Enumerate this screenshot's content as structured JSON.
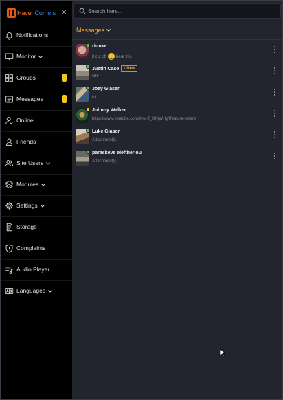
{
  "app": {
    "brand_part1": "Haven",
    "brand_part2": "Comms",
    "close_glyph": "×"
  },
  "sidebar": {
    "items": [
      {
        "label": "Notifications",
        "icon": "bell-icon",
        "has_chevron": false,
        "badge": false
      },
      {
        "label": "Monitor",
        "icon": "monitor-icon",
        "has_chevron": true,
        "badge": false
      },
      {
        "label": "Groups",
        "icon": "grid-icon",
        "has_chevron": false,
        "badge": true
      },
      {
        "label": "Messages",
        "icon": "message-icon",
        "has_chevron": false,
        "badge": true
      },
      {
        "label": "Online",
        "icon": "user-online-icon",
        "has_chevron": false,
        "badge": false
      },
      {
        "label": "Friends",
        "icon": "friends-icon",
        "has_chevron": false,
        "badge": false
      },
      {
        "label": "Site Users",
        "icon": "users-icon",
        "has_chevron": true,
        "badge": false
      },
      {
        "label": "Modules",
        "icon": "layers-icon",
        "has_chevron": true,
        "badge": false
      },
      {
        "label": "Settings",
        "icon": "gear-icon",
        "has_chevron": true,
        "badge": false
      },
      {
        "label": "Storage",
        "icon": "storage-icon",
        "has_chevron": false,
        "badge": false
      },
      {
        "label": "Complaints",
        "icon": "shield-icon",
        "has_chevron": false,
        "badge": false
      },
      {
        "label": "Audio Player",
        "icon": "playlist-icon",
        "has_chevron": false,
        "badge": false
      },
      {
        "label": "Languages",
        "icon": "translate-icon",
        "has_chevron": true,
        "badge": false
      }
    ]
  },
  "search": {
    "placeholder": "Search here..."
  },
  "messages": {
    "header": "Messages",
    "conversations": [
      {
        "name": "rfunke",
        "preview_pre": "it cut off",
        "preview_post": "here it is",
        "has_emoji": true,
        "status": "online",
        "new_label": ""
      },
      {
        "name": "Justin Case",
        "preview_pre": "GIF",
        "preview_post": "",
        "has_emoji": false,
        "status": "online",
        "new_label": "1 New"
      },
      {
        "name": "Joey Glaser",
        "preview_pre": "lol",
        "preview_post": "",
        "has_emoji": false,
        "status": "online",
        "new_label": ""
      },
      {
        "name": "Johnny Walker",
        "preview_pre": "https://www.youtube.com/live/-T_0tvjWHg?feature=share",
        "preview_post": "",
        "has_emoji": false,
        "status": "away",
        "new_label": ""
      },
      {
        "name": "Luke Glaser",
        "preview_pre": "Attachment(s)",
        "preview_post": "",
        "has_emoji": false,
        "status": "online",
        "new_label": ""
      },
      {
        "name": "paraskeve eleftheriou",
        "preview_pre": "Attachment(s)",
        "preview_post": "",
        "has_emoji": false,
        "status": "online",
        "new_label": ""
      }
    ]
  },
  "colors": {
    "accent_orange": "#f2a93b",
    "badge_yellow": "#f5c518",
    "online_green": "#4cd137",
    "away_yellow": "#f5c518",
    "sidebar_bg": "#000000",
    "main_bg": "#22242e"
  }
}
